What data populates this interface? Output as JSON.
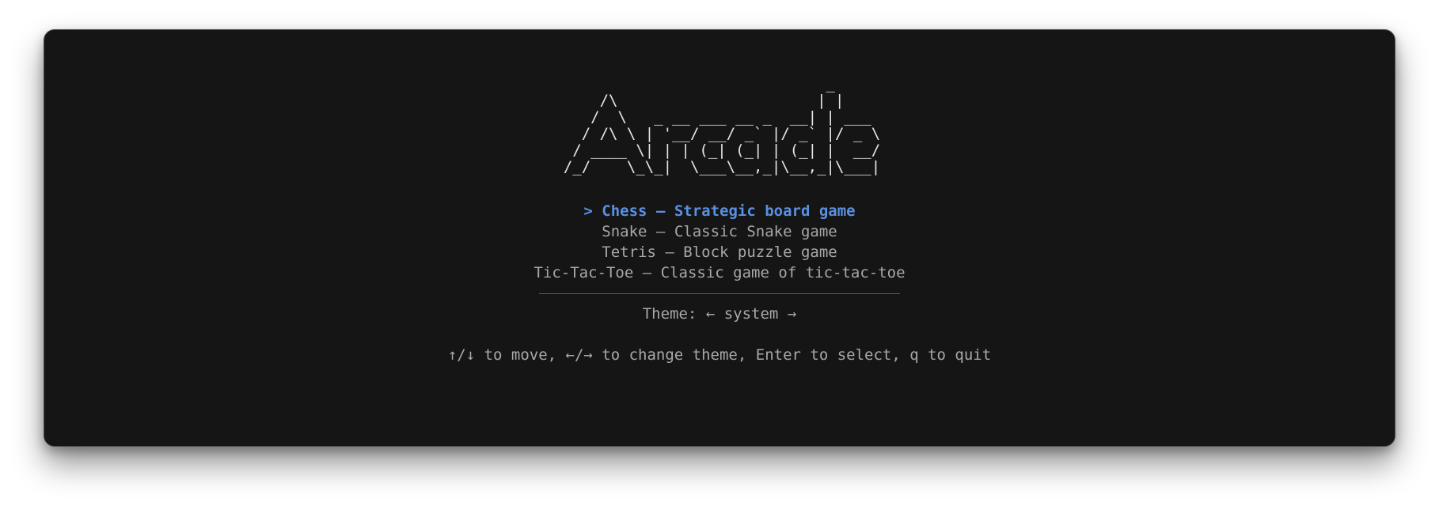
{
  "logo": {
    "ascii_art": "                             _ \n    /\\                      | |\n   /  \\   _ __ ___ __ _  __| | ___\n  / /\\ \\ | '__/ __/ _` |/ _` |/ _ \\\n / ____ \\| | | (_| (_| | (_| |  __/\n/_/    \\_\\_|  \\___\\__,_|\\__,_|\\___|"
  },
  "menu": {
    "pointer": ">",
    "separator": "—",
    "items": [
      {
        "name": "Chess",
        "description": "Strategic board game",
        "selected": true
      },
      {
        "name": "Snake",
        "description": "Classic Snake game",
        "selected": false
      },
      {
        "name": "Tetris",
        "description": "Block puzzle game",
        "selected": false
      },
      {
        "name": "Tic-Tac-Toe",
        "description": "Classic game of tic-tac-toe",
        "selected": false
      }
    ]
  },
  "theme": {
    "label": "Theme:",
    "left_arrow": "←",
    "value": "system",
    "right_arrow": "→"
  },
  "help": {
    "text": "↑/↓ to move, ←/→ to change theme, Enter to select, q to quit"
  },
  "colors": {
    "background": "#151515",
    "text": "#a8a8a8",
    "selected": "#5b8fe0",
    "logo": "#e6e6e6"
  }
}
